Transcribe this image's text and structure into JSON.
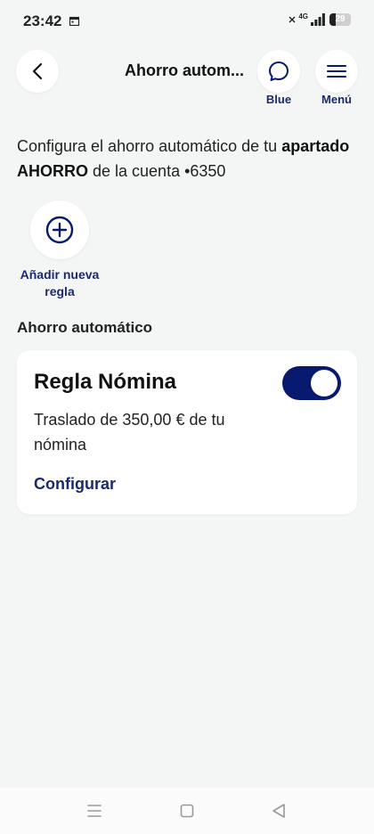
{
  "status_bar": {
    "time": "23:42",
    "network": "4G",
    "battery": "29",
    "battery_level": 0.29
  },
  "header": {
    "title": "Ahorro autom...",
    "chat_label": "Blue",
    "menu_label": "Menú"
  },
  "intro": {
    "prefix": "Configura el ahorro automático de tu ",
    "bold_part": "apartado AHORRO",
    "suffix": " de la cuenta •6350"
  },
  "add_rule": {
    "label": "Añadir nueva regla"
  },
  "section": {
    "title": "Ahorro automático"
  },
  "rule": {
    "name": "Regla Nómina",
    "enabled": true,
    "description": "Traslado de 350,00 € de tu nómina",
    "configure_label": "Configurar"
  },
  "colors": {
    "accent": "#071a6e",
    "link": "#1a2a6c",
    "background": "#f4f6f6",
    "card": "#ffffff"
  },
  "icons": {
    "back": "chevron-left-icon",
    "chat": "chat-bubble-icon",
    "menu": "hamburger-menu-icon",
    "add": "plus-circle-icon"
  }
}
